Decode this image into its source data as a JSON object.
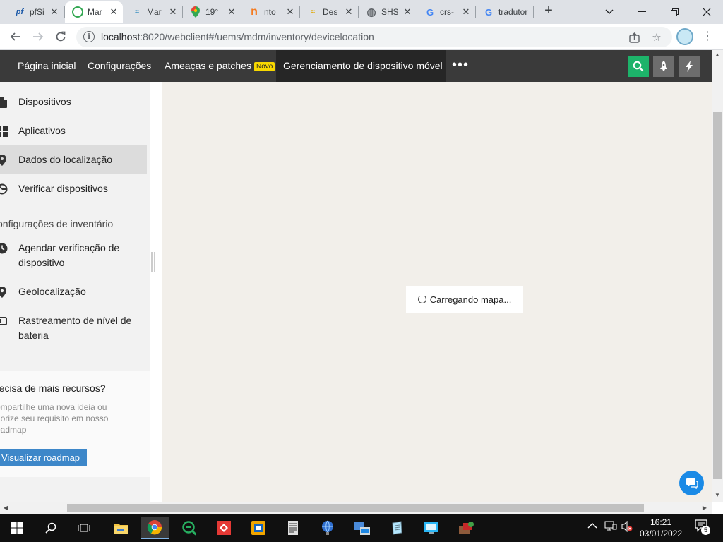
{
  "browser": {
    "tabs": [
      {
        "title": "pfSi",
        "icon": "pfsense-icon",
        "fav_text": "pf",
        "fav_color": "#1d5aa8",
        "active": false
      },
      {
        "title": "Mar",
        "icon": "manageengine-icon",
        "fav_text": "☉",
        "fav_color": "#e8a000",
        "active": true
      },
      {
        "title": "Mar",
        "icon": "wave-icon",
        "fav_text": "≈",
        "fav_color": "#5aa0c8",
        "active": false
      },
      {
        "title": "19°",
        "icon": "maps-pin-icon",
        "fav_text": "●",
        "fav_color": "#34a853",
        "active": false
      },
      {
        "title": "nto",
        "icon": "n-letter-icon",
        "fav_text": "n",
        "fav_color": "#f47a1f",
        "active": false
      },
      {
        "title": "Des",
        "icon": "wave-icon",
        "fav_text": "≈",
        "fav_color": "#e0b020",
        "active": false
      },
      {
        "title": "SHS",
        "icon": "globe-icon",
        "fav_text": "◍",
        "fav_color": "#5f6368",
        "active": false
      },
      {
        "title": "crs-",
        "icon": "google-icon",
        "fav_text": "G",
        "fav_color": "#4285f4",
        "active": false
      },
      {
        "title": "tradutor",
        "icon": "google-icon",
        "fav_text": "G",
        "fav_color": "#4285f4",
        "active": false
      }
    ],
    "url_host": "localhost",
    "url_rest": ":8020/webclient#/uems/mdm/inventory/devicelocation"
  },
  "appnav": {
    "home": "Página inicial",
    "settings": "Configurações",
    "threats": "Ameaças e patches",
    "threats_badge": "Novo",
    "mdm": "Gerenciamento de dispositivo móvel",
    "more": "•••"
  },
  "sidebar": {
    "items": [
      {
        "label": "Dispositivos",
        "icon": "devices-icon"
      },
      {
        "label": "Aplicativos",
        "icon": "apps-grid-icon"
      },
      {
        "label": "Dados do localização",
        "icon": "location-pin-icon"
      },
      {
        "label": "Verificar dispositivos",
        "icon": "scan-icon"
      }
    ],
    "heading": "onfigurações de inventário",
    "settings_items": [
      {
        "label_line1": "Agendar verificação de",
        "label_line2": "dispositivo",
        "icon": "clock-icon"
      },
      {
        "label_line1": "Geolocalização",
        "icon": "geo-pin-icon"
      },
      {
        "label_line1": "Rastreamento de nível de",
        "label_line2": "bateria",
        "icon": "battery-icon"
      }
    ],
    "promo": {
      "title": "recisa de mais recursos?",
      "text": "ompartilhe uma nova ideia ou riorize seu requisito em nosso oadmap",
      "button": "Visualizar roadmap"
    }
  },
  "map": {
    "loading_text": "Carregando mapa..."
  },
  "taskbar": {
    "time": "16:21",
    "date": "03/01/2022",
    "notifications": "5"
  },
  "colors": {
    "nav_bg": "#3a3a3a",
    "search_green": "#1db36a",
    "roadmap_blue": "#3d87c9",
    "chat_blue": "#1a8ae6",
    "new_badge": "#f8d800"
  }
}
